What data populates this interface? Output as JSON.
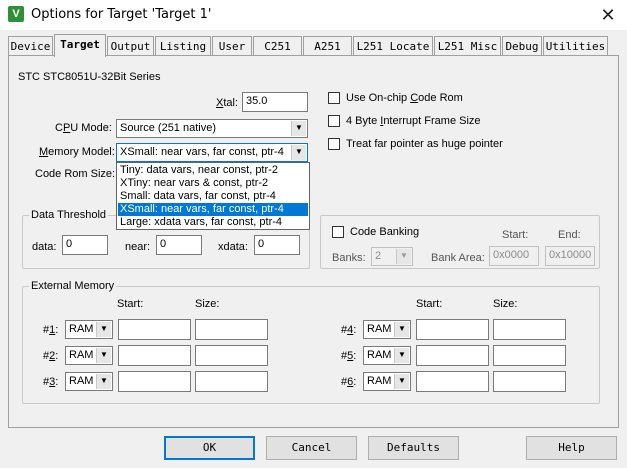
{
  "window": {
    "title": "Options for Target 'Target 1'",
    "app_icon": "uvision-icon",
    "app_icon_glyph": "V"
  },
  "tabs": [
    {
      "label": "Device",
      "active": false
    },
    {
      "label": "Target",
      "active": true
    },
    {
      "label": "Output",
      "active": false
    },
    {
      "label": "Listing",
      "active": false
    },
    {
      "label": "User",
      "active": false
    },
    {
      "label": "C251",
      "active": false
    },
    {
      "label": "A251",
      "active": false
    },
    {
      "label": "L251 Locate",
      "active": false
    },
    {
      "label": "L251 Misc",
      "active": false
    },
    {
      "label": "Debug",
      "active": false
    },
    {
      "label": "Utilities",
      "active": false
    }
  ],
  "device_name": "STC STC8051U-32Bit Series",
  "xtal": {
    "label_underlined": "X",
    "label_rest": "tal:",
    "value": "35.0"
  },
  "cpu_mode": {
    "label_pre": "C",
    "label_u": "P",
    "label_post": "U Mode:",
    "value": "Source (251 native)"
  },
  "memory_model": {
    "label_u": "M",
    "label_rest": "emory Model:",
    "value": "XSmall: near vars, far const, ptr-4"
  },
  "code_rom_size": {
    "label": "Code Rom Size:"
  },
  "memory_model_options": [
    {
      "label": "Tiny: data vars, near const, ptr-2",
      "selected": false
    },
    {
      "label": "XTiny: near vars & const, ptr-2",
      "selected": false
    },
    {
      "label": "Small: data vars, far const, ptr-4",
      "selected": false
    },
    {
      "label": "XSmall: near vars, far const, ptr-4",
      "selected": true
    },
    {
      "label": "Large: xdata vars, far const, ptr-4",
      "selected": false
    }
  ],
  "options_right": {
    "use_onchip_rom": {
      "pre": "Use On-chip ",
      "u": "C",
      "post": "ode Rom",
      "checked": false
    },
    "four_byte_irq": {
      "pre": "4 Byte ",
      "u": "I",
      "post": "nterrupt Frame Size",
      "checked": false
    },
    "far_pointer": {
      "label": "Treat far pointer as huge pointer",
      "checked": false
    }
  },
  "data_threshold": {
    "title": "Data Threshold",
    "data_label": "data:",
    "data_value": "0",
    "near_label": "near:",
    "near_value": "0",
    "xdata_label": "xdata:",
    "xdata_value": "0"
  },
  "code_banking": {
    "label": "Code Banking",
    "checked": false,
    "start_label": "Start:",
    "end_label": "End:",
    "banks_label": "Banks:",
    "banks_value": "2",
    "bank_area_label": "Bank Area:",
    "start_value": "0x0000",
    "end_value": "0x10000"
  },
  "external_memory": {
    "title": "External Memory",
    "start_label": "Start:",
    "size_label": "Size:",
    "rows_left": [
      {
        "label_pre": "#",
        "label_u": "1",
        "label_post": ":",
        "type": "RAM",
        "start": "",
        "size": ""
      },
      {
        "label_pre": "#",
        "label_u": "2",
        "label_post": ":",
        "type": "RAM",
        "start": "",
        "size": ""
      },
      {
        "label_pre": "#",
        "label_u": "3",
        "label_post": ":",
        "type": "RAM",
        "start": "",
        "size": ""
      }
    ],
    "rows_right": [
      {
        "label_pre": "#",
        "label_u": "4",
        "label_post": ":",
        "type": "RAM",
        "start": "",
        "size": ""
      },
      {
        "label_pre": "#",
        "label_u": "5",
        "label_post": ":",
        "type": "RAM",
        "start": "",
        "size": ""
      },
      {
        "label_pre": "#",
        "label_u": "6",
        "label_post": ":",
        "type": "RAM",
        "start": "",
        "size": ""
      }
    ]
  },
  "buttons": {
    "ok": "OK",
    "cancel": "Cancel",
    "defaults": "Defaults",
    "help": "Help"
  },
  "icons": {
    "close": "close-icon",
    "dropdown": "chevron-down-icon",
    "close_glyph": "✕",
    "dropdown_glyph": "▼"
  },
  "colors": {
    "selection": "#0078d7",
    "app_icon_bg": "#2f8f3a"
  }
}
